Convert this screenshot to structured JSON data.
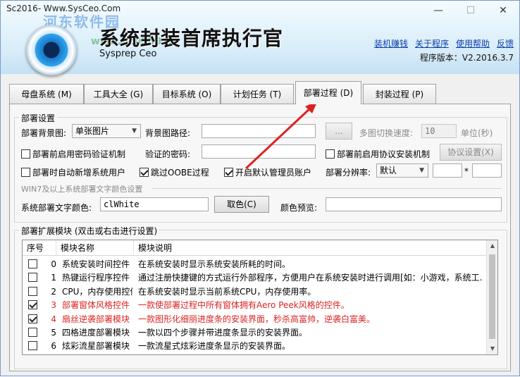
{
  "window": {
    "title": "Sc2016- Www.SysCeo.Com",
    "minimize": "—",
    "maximize": "☐",
    "close": "✕"
  },
  "watermark": {
    "line1": "河东软件园",
    "line2": "www.pc0359.cn"
  },
  "app": {
    "title": "系统封装首席执行官",
    "subtitle": "Sysprep  Ceo",
    "links": [
      "装机赚钱",
      "关于程序",
      "使用帮助",
      "反馈"
    ],
    "version": "程序版本：V2.2016.3.7"
  },
  "tabs": [
    "母盘系统 (M)",
    "工具大全 (G)",
    "目标系统 (O)",
    "计划任务 (T)",
    "部署过程 (D)",
    "封装过程 (P)"
  ],
  "deploy": {
    "group_title": "部署设置",
    "bg_label": "部署背景图:",
    "bg_value": "单张图片",
    "bg_path_label": "背景图路径:",
    "bg_path_value": "",
    "browse": "...",
    "switch_speed_label": "多图切换速度:",
    "switch_speed_value": "10",
    "unit_label": "单位(秒)",
    "pwd_checkbox": "部署前启用密码验证机制",
    "pwd_label": "验证的密码:",
    "pwd_value": "",
    "protocol_checkbox": "部署前启用协议安装机制",
    "protocol_button": "协议设置(X)",
    "auto_user_checkbox": "部署时自动新增系统用户",
    "skip_oobe_checkbox": "跳过OOBE过程",
    "admin_checkbox": "开启默认管理员账户",
    "resolution_label": "部署分辨率:",
    "resolution_value": "默认",
    "res_w": "",
    "res_sep": "*",
    "res_h": "",
    "win7_title": "WIN7及以上系统部署文字颜色设置",
    "color_label": "系统部署文字颜色:",
    "color_value": "clWhite",
    "pick_color": "取色(C)",
    "preview_label": "颜色预览:"
  },
  "modules": {
    "group_title": "部署扩展模块 (双击或右击进行设置)",
    "columns": [
      "序号",
      "模块名称",
      "模块说明"
    ],
    "rows": [
      {
        "checked": false,
        "no": "0",
        "name": "系统安装时间控件",
        "desc": "在系统安装时显示系统安装所耗的时间。",
        "red": false
      },
      {
        "checked": false,
        "no": "1",
        "name": "热键运行程序控件",
        "desc": "通过注册快捷键的方式运行外部程序，方便用户在系统安装时进行调用[如：小游戏，系统工...",
        "red": false
      },
      {
        "checked": false,
        "no": "2",
        "name": "CPU，内存使用控件",
        "desc": "在系统安装时显示当前系统CPU，内存使用率。",
        "red": false
      },
      {
        "checked": true,
        "no": "3",
        "name": "部署窗体风格控件",
        "desc": "一款使部署过程中所有窗体拥有Aero Peek风格的控件。",
        "red": true
      },
      {
        "checked": true,
        "no": "4",
        "name": "扇丝逆袭部署模块",
        "desc": "一款图形化细丽进度条的安装界面，秒杀高富帅，逆袭白富美。",
        "red": true
      },
      {
        "checked": false,
        "no": "5",
        "name": "四格进度部署模块",
        "desc": "一款以四个步骤并带进度条显示的安装界面。",
        "red": false
      },
      {
        "checked": false,
        "no": "6",
        "name": "炫彩流星部署模块",
        "desc": "一款流星式炫彩进度条显示的安装界面。",
        "red": false
      }
    ]
  },
  "colors": {
    "red_row": "#dd2222",
    "link": "#0b3fa8",
    "annotation_arrow": "#e02020"
  }
}
